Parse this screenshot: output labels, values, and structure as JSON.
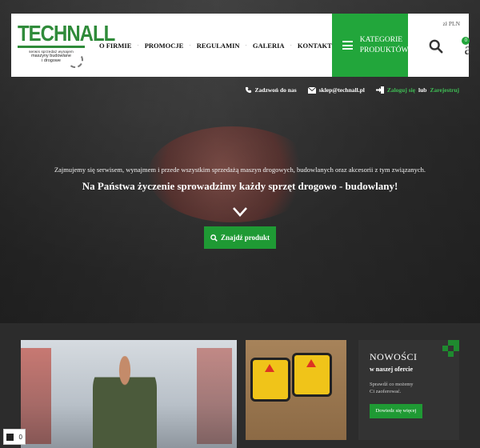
{
  "logo": {
    "word": "TECHNALL",
    "tagline_small": "serwis  sprzedaż  wynajem",
    "tagline_1": "maszyny budowlane",
    "tagline_2": "i drogowe"
  },
  "nav": {
    "items": [
      {
        "label": "O FIRMIE"
      },
      {
        "label": "PROMOCJE"
      },
      {
        "label": "REGULAMIN"
      },
      {
        "label": "GALERIA"
      },
      {
        "label": "KONTAKT"
      }
    ],
    "separator": "·"
  },
  "categories_button": {
    "line1": "KATEGORIE",
    "line2": "PRODUKTÓW"
  },
  "header_tools": {
    "currency": "zł PLN",
    "cart_count": "0",
    "cart_glyph": "a",
    "icons": [
      "search-icon",
      "cart-icon",
      "chevron-down-icon"
    ]
  },
  "contact_bar": {
    "phone": "Zadzwoń do nas",
    "email": "sklep@technall.pl",
    "login": "Zaloguj się",
    "or": "lub",
    "register": "Zarejestruj"
  },
  "hero": {
    "subtitle": "Zajmujemy się serwisem, wynajmem i przede wszystkim sprzedażą maszyn drogowych, budowlanych oraz akcesorii z tym związanych.",
    "title": "Na Państwa życzenie sprowadzimy każdy sprzęt drogowo - budowlany!",
    "button": "Znajdź produkt"
  },
  "news_card": {
    "title": "NOWOŚCI",
    "subtitle": "w naszej ofercie",
    "text_1": "Sprawdź co możemy",
    "text_2": "Ci zaoferować.",
    "button": "Dowiedz się więcej"
  },
  "floating_cart": {
    "count": "0"
  },
  "colors": {
    "brand_green": "#22a63b",
    "logo_green": "#2f8b3a",
    "dark_bg": "#2c2c2c"
  }
}
